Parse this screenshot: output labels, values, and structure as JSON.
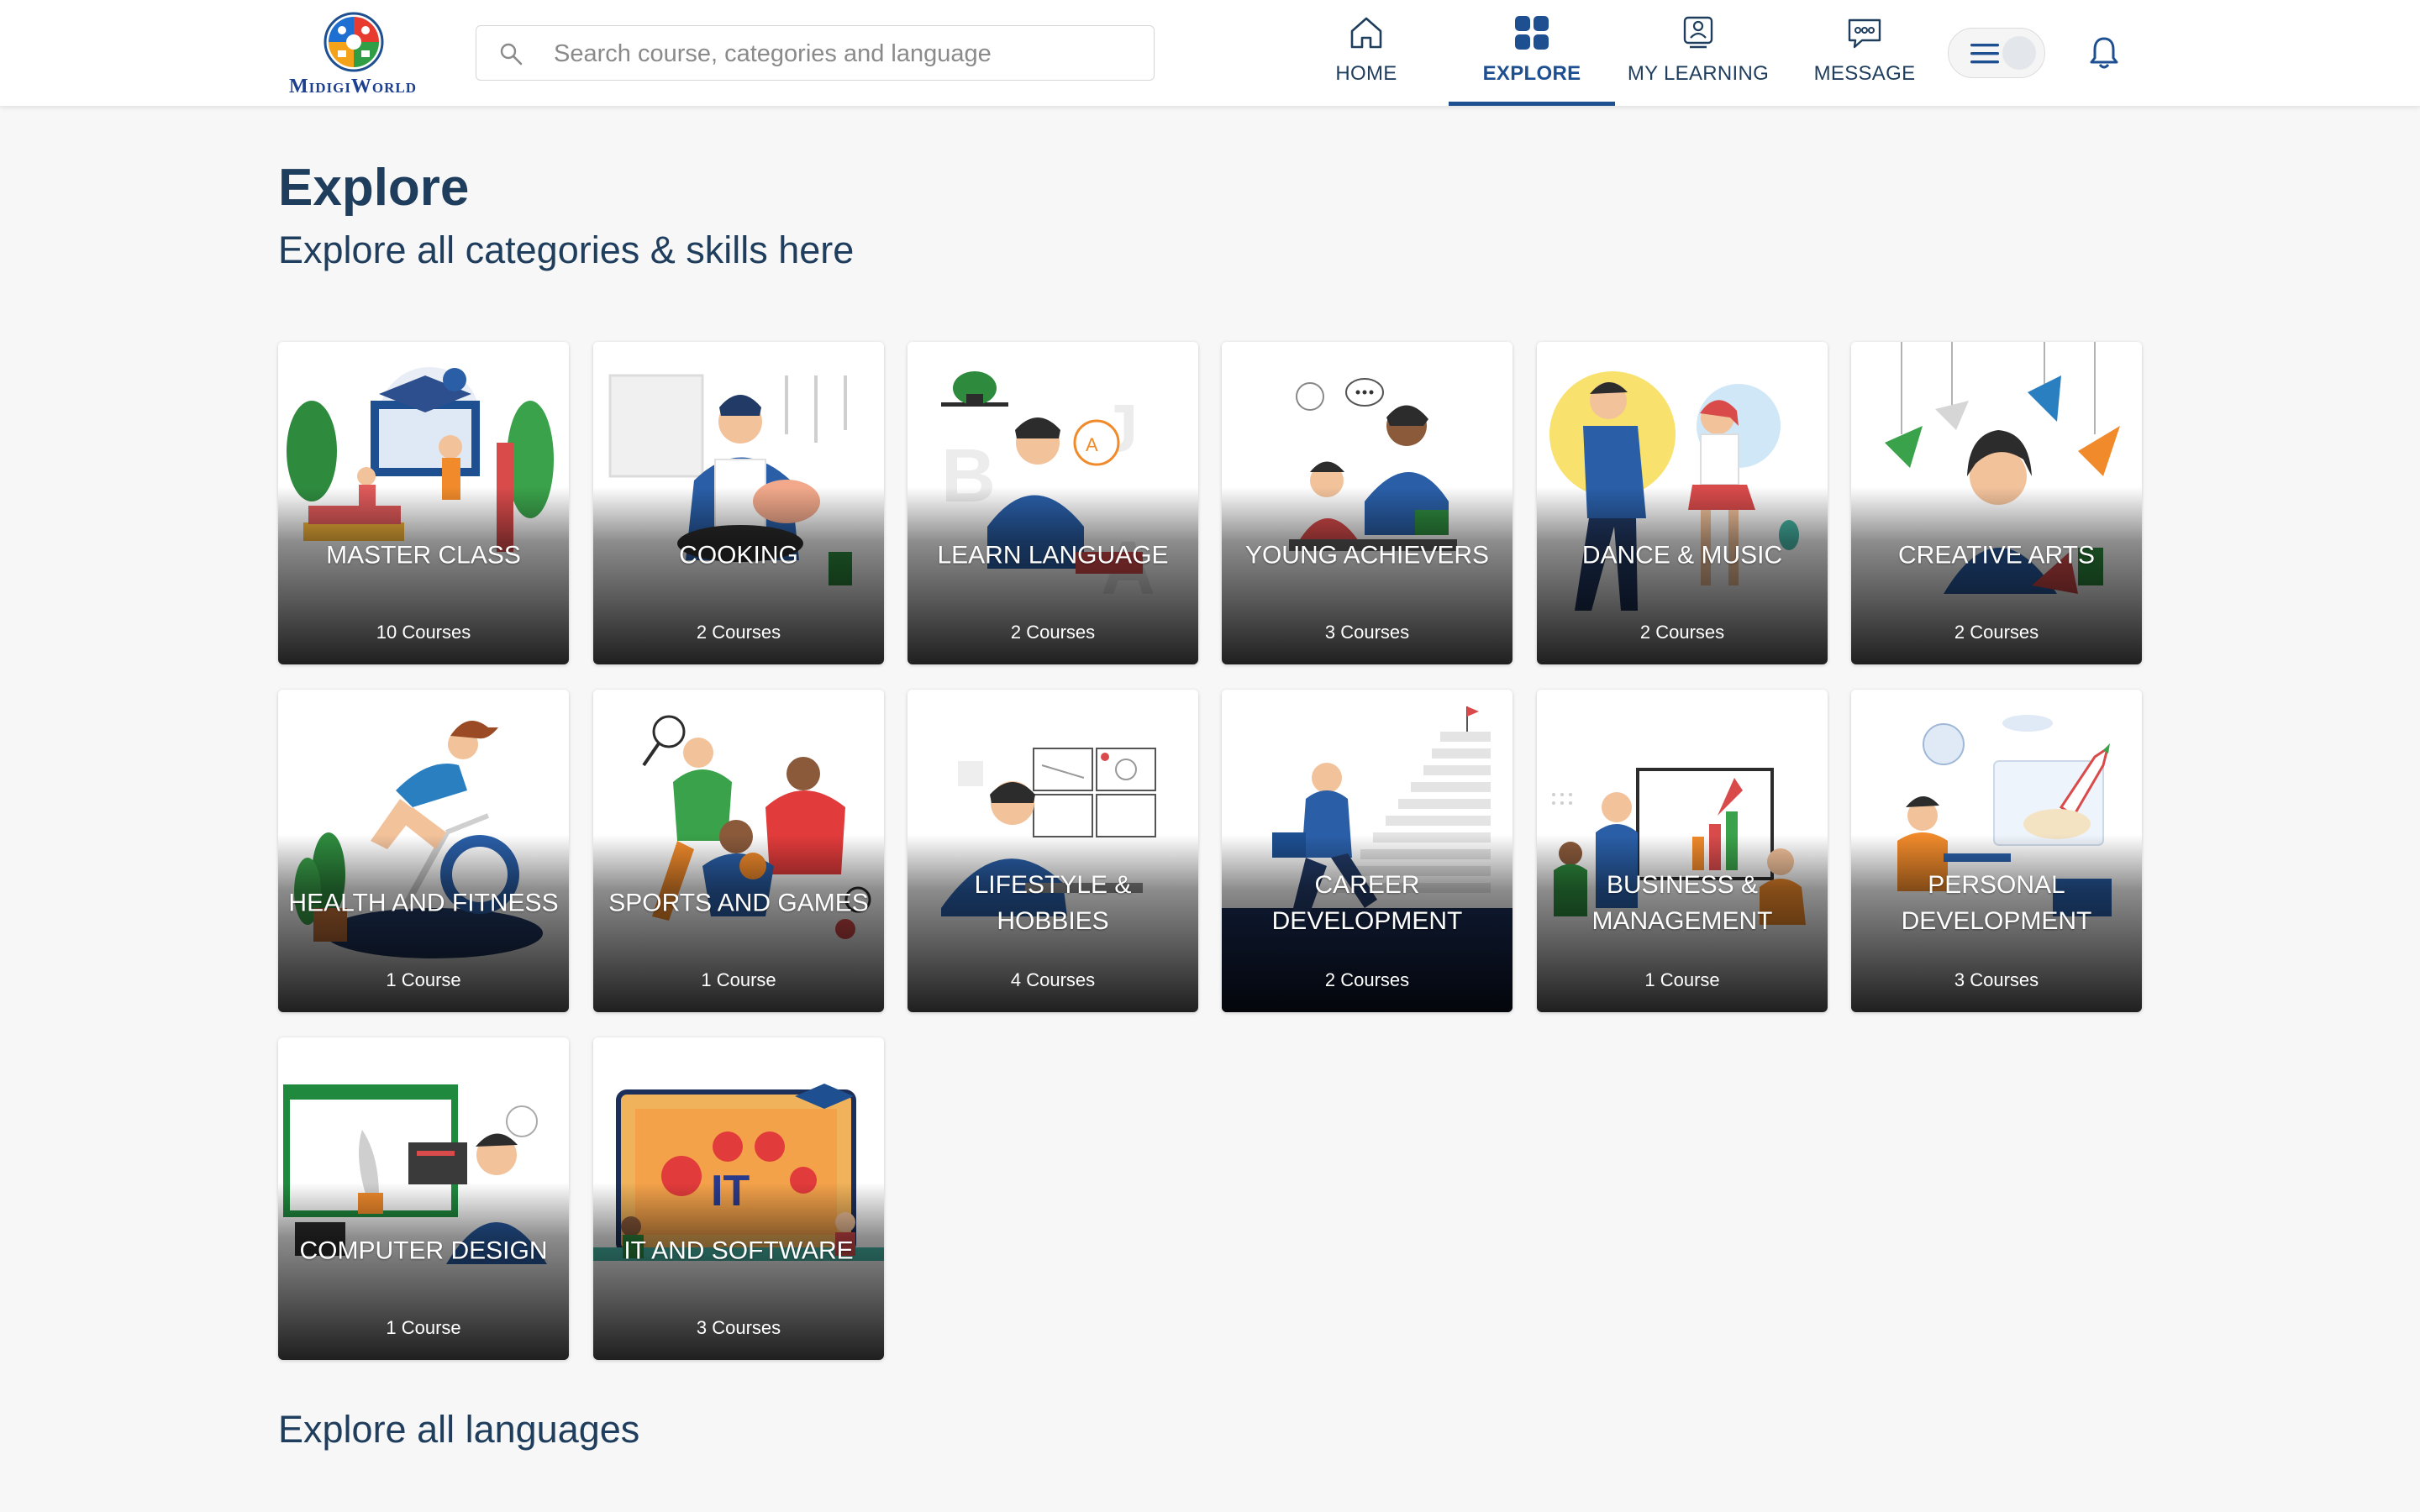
{
  "brand": {
    "name": "MidigiWorld"
  },
  "search": {
    "placeholder": "Search course, categories and language"
  },
  "nav": {
    "home": "HOME",
    "explore": "EXPLORE",
    "my_learning": "MY LEARNING",
    "message": "MESSAGE"
  },
  "page": {
    "title": "Explore",
    "subtitle": "Explore all categories & skills here",
    "languages_heading": "Explore all languages"
  },
  "categories": [
    {
      "title": "Master Class",
      "count": "10 Courses",
      "scene": "books-graduation"
    },
    {
      "title": "Cooking",
      "count": "2 Courses",
      "scene": "chef-kitchen"
    },
    {
      "title": "Learn Language",
      "count": "2 Courses",
      "scene": "student-letters"
    },
    {
      "title": "Young Achievers",
      "count": "3 Courses",
      "scene": "kids-reading"
    },
    {
      "title": "Dance & Music",
      "count": "2 Courses",
      "scene": "dancers"
    },
    {
      "title": "Creative Arts",
      "count": "2 Courses",
      "scene": "origami-birds"
    },
    {
      "title": "Health and Fitness",
      "count": "1 Course",
      "scene": "spin-bike"
    },
    {
      "title": "Sports and Games",
      "count": "1 Course",
      "scene": "athletes"
    },
    {
      "title": "Lifestyle & Hobbies",
      "count": "4 Courses",
      "scene": "sketching"
    },
    {
      "title": "Career Development",
      "count": "2 Courses",
      "scene": "stairs-climb"
    },
    {
      "title": "Business & Management",
      "count": "1 Course",
      "scene": "presentation-chart"
    },
    {
      "title": "Personal Development",
      "count": "3 Courses",
      "scene": "rocket-laptop"
    },
    {
      "title": "Computer Design",
      "count": "1 Course",
      "scene": "designer-desk"
    },
    {
      "title": "IT and Software",
      "count": "3 Courses",
      "scene": "it-laptop"
    }
  ],
  "colors": {
    "primary": "#1d4f91",
    "heading": "#1f3d5c",
    "page_background": "#f7f7f7"
  },
  "icons": {
    "search": "search-icon",
    "home": "home-icon",
    "explore": "explore-grid-icon",
    "my_learning": "learning-icon",
    "message": "message-icon",
    "menu": "hamburger-icon",
    "notifications": "bell-icon"
  }
}
